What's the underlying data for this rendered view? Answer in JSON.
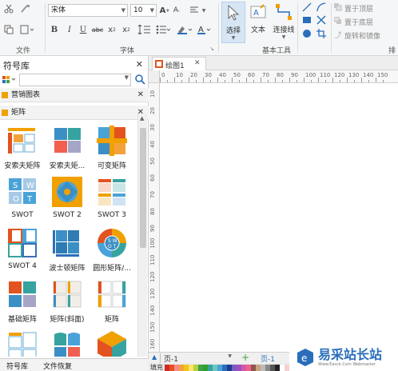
{
  "ribbon": {
    "file_group": "文件",
    "font_group": "字体",
    "basic_tools_group": "基本工具",
    "arrange_group_partial": "排",
    "font_name": "宋体",
    "font_size": "10",
    "tools": [
      {
        "label": "选择"
      },
      {
        "label": "文本"
      },
      {
        "label": "连接线"
      }
    ],
    "arrange": {
      "bring_front": "置于顶层",
      "send_back": "置于底层",
      "rotate_flip": "旋转和镜像"
    }
  },
  "symbol_panel": {
    "title": "符号库",
    "search_placeholder": "",
    "categories": [
      {
        "label": "营销图表"
      },
      {
        "label": "矩阵"
      }
    ],
    "shapes": [
      {
        "label": "安索夫矩阵"
      },
      {
        "label": "安索夫矩..."
      },
      {
        "label": "可变矩阵"
      },
      {
        "label": "SWOT"
      },
      {
        "label": "SWOT 2"
      },
      {
        "label": "SWOT 3"
      },
      {
        "label": "SWOT 4"
      },
      {
        "label": "波士顿矩阵"
      },
      {
        "label": "圆形矩阵/..."
      },
      {
        "label": "基础矩阵"
      },
      {
        "label": "矩阵(斜面)"
      },
      {
        "label": "矩阵"
      },
      {
        "label": ""
      },
      {
        "label": ""
      },
      {
        "label": ""
      }
    ],
    "bottom_tabs": [
      {
        "label": "符号库"
      },
      {
        "label": "文件恢复"
      }
    ]
  },
  "document": {
    "tab_title": "绘图1",
    "ruler_marks": [
      "0",
      "10",
      "20",
      "30",
      "40",
      "50",
      "60",
      "70",
      "80",
      "90",
      "100",
      "110",
      "120",
      "130",
      "140",
      "150"
    ],
    "vruler_marks": [
      "10",
      "20",
      "30",
      "40",
      "50",
      "60",
      "70",
      "80",
      "90",
      "100",
      "110",
      "120",
      "130",
      "140",
      "150",
      "160"
    ],
    "page_selector": "页-1",
    "page_tab": "页-1",
    "fill_label": "填充"
  },
  "watermark": {
    "brand": "易采站长站",
    "url": "Www.Easck.Com Webmaster"
  },
  "colors": {
    "accent": "#2a6ebb",
    "selected_tool_bg": "#d7e6f5"
  }
}
